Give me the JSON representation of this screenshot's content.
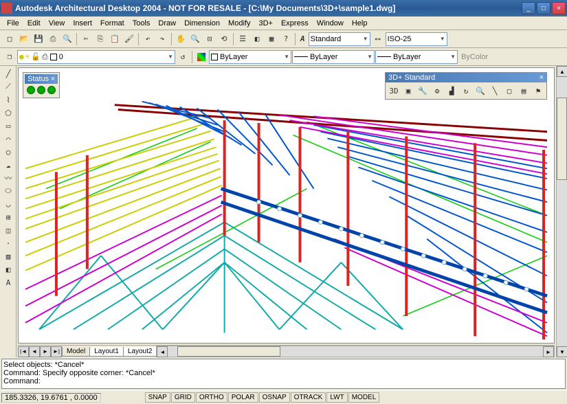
{
  "title": "Autodesk Architectural Desktop 2004 - NOT FOR RESALE - [C:\\My Documents\\3D+\\sample1.dwg]",
  "menu": [
    "File",
    "Edit",
    "View",
    "Insert",
    "Format",
    "Tools",
    "Draw",
    "Dimension",
    "Modify",
    "3D+",
    "Express",
    "Window",
    "Help"
  ],
  "toolbar1": {
    "style_combo": "Standard",
    "dimstyle_combo": "ISO-25"
  },
  "toolbar2": {
    "layer": "0",
    "linetype": "ByLayer",
    "lineweight": "ByLayer",
    "plotstyle": "ByLayer",
    "color_label": "ByColor"
  },
  "status_panel": {
    "title": "Status",
    "close": "×"
  },
  "float_toolbar": {
    "title": "3D+ Standard",
    "close": "×"
  },
  "tabs": {
    "nav_first": "|◄",
    "nav_prev": "◄",
    "nav_next": "►",
    "nav_last": "►|",
    "items": [
      "Model",
      "Layout1",
      "Layout2"
    ]
  },
  "cmd": {
    "line1": "Select objects: *Cancel*",
    "line2": "Command: Specify opposite corner: *Cancel*",
    "line3": "Command:"
  },
  "statusbar": {
    "coords": "185.3326, 19.6761 , 0.0000",
    "toggles": [
      "SNAP",
      "GRID",
      "ORTHO",
      "POLAR",
      "OSNAP",
      "OTRACK",
      "LWT",
      "MODEL"
    ]
  },
  "icons": {
    "new": "□",
    "open": "📂",
    "save": "💾",
    "print": "⎙",
    "preview": "🔍",
    "cut": "✂",
    "copy": "⎘",
    "paste": "📋",
    "undo": "↶",
    "redo": "↷",
    "pan": "✋",
    "zoom": "🔍",
    "textstyle": "A"
  }
}
